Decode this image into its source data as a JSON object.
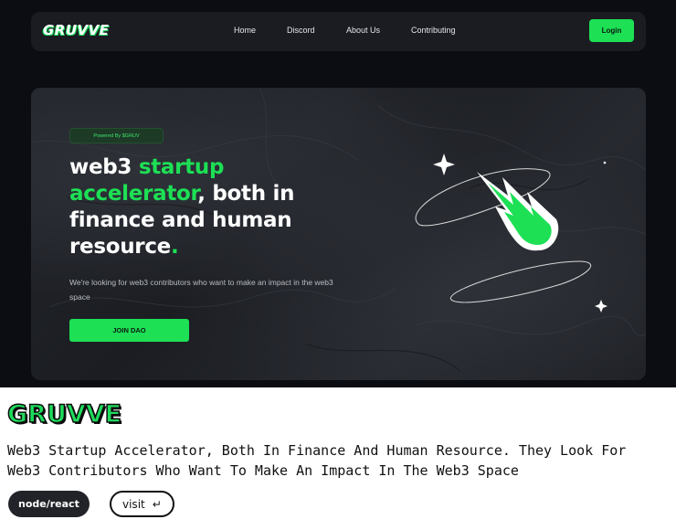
{
  "navbar": {
    "logo": "GRUVVE",
    "links": [
      "Home",
      "Discord",
      "About Us",
      "Contributing"
    ],
    "login_label": "Login"
  },
  "hero": {
    "badge": "Powered By $GRUV",
    "headline": {
      "part1": "web3 ",
      "part2_green": "startup accelerator",
      "part3": ", both in finance and human resource",
      "part4_green": "."
    },
    "subtitle": "We're looking for web3 contributors who want to make an impact in the web3 space",
    "cta_label": "JOIN DAO"
  },
  "card": {
    "logo": "GRUVVE",
    "description": "Web3 Startup Accelerator, Both In Finance And Human Resource. They Look For Web3 Contributors Who Want To Make An Impact In The Web3 Space",
    "tag": "node/react",
    "visit_label": "visit",
    "visit_icon": "return-arrow-icon",
    "visit_glyph": "↵"
  },
  "colors": {
    "accent": "#1de055",
    "background": "#0c0d12",
    "card_bg": "#ffffff"
  }
}
